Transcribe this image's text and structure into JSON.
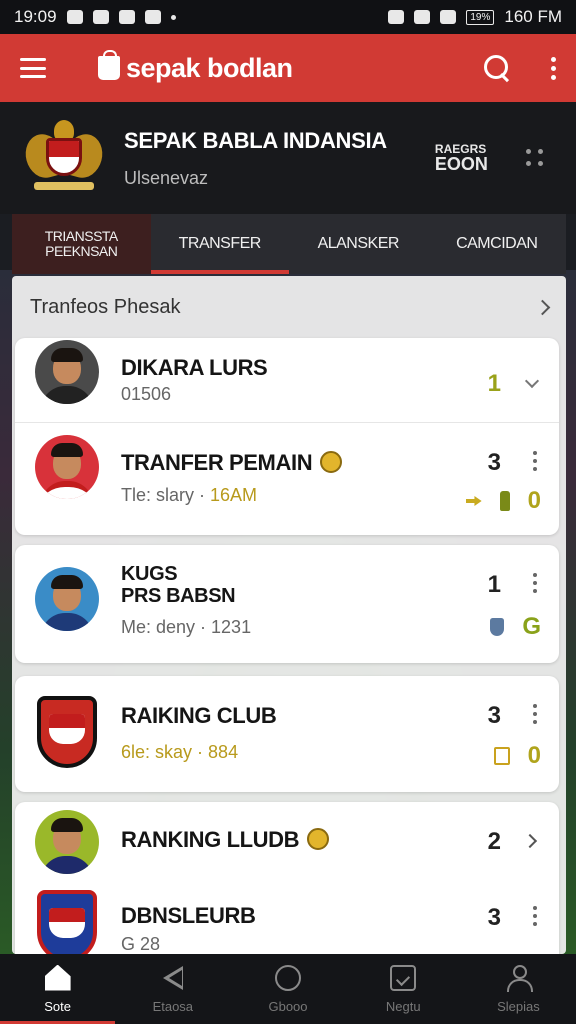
{
  "status_bar": {
    "time": "19:09",
    "right_time": "160 FM",
    "battery_label": "19%"
  },
  "app_bar": {
    "brand": "sepak bodlan"
  },
  "header": {
    "title": "SEPAK BABLA INDANSIA",
    "subtitle": "Ulsenevaz",
    "badge_line1": "RAEGRS",
    "badge_line2": "EOON"
  },
  "tabs": [
    {
      "label": "TRIANSSTA PEEKNSAN",
      "active": true
    },
    {
      "label": "TRANSFER",
      "active": false,
      "highlight": true
    },
    {
      "label": "ALANSKER",
      "active": false
    },
    {
      "label": "CAMCIDAN",
      "active": false
    }
  ],
  "main": {
    "section_title": "Tranfeos Phesak",
    "rows": [
      {
        "title": "DIKARA LURS",
        "subtitle": "01506",
        "count": "1",
        "avatar": "player-1"
      },
      {
        "title": "TRANFER PEMAIN",
        "sub_label": "Tle: slary ·",
        "sub_value": "16AM",
        "count": "3",
        "stat_value": "0",
        "avatar": "player-2"
      },
      {
        "title_line1": "KUGS",
        "title_line2": "PRS BABSN",
        "subtitle": "Me: deny · 1231",
        "count": "1",
        "stat_value": "G",
        "avatar": "player-3"
      },
      {
        "title": "RAIKING CLUB",
        "sub_label": "6le: skay ·",
        "sub_value": "884",
        "count": "3",
        "stat_value": "0",
        "avatar": "club-1"
      },
      {
        "title": "RANKING LLUDB",
        "count": "2",
        "avatar": "player-4"
      },
      {
        "title": "DBNSLEURB",
        "subtitle": "G 28",
        "count": "3",
        "avatar": "club-2"
      }
    ]
  },
  "bottom_nav": [
    {
      "label": "Sote",
      "icon": "home-icon",
      "active": true
    },
    {
      "label": "Etaosa",
      "icon": "back-icon",
      "active": false
    },
    {
      "label": "Gbooo",
      "icon": "chat-icon",
      "active": false
    },
    {
      "label": "Negtu",
      "icon": "photo-icon",
      "active": false
    },
    {
      "label": "Slepias",
      "icon": "person-icon",
      "active": false
    }
  ],
  "colors": {
    "accent_red": "#d13a34",
    "dark_bg": "#18191c",
    "olive": "#9aa21a",
    "gold": "#b89a1c"
  }
}
